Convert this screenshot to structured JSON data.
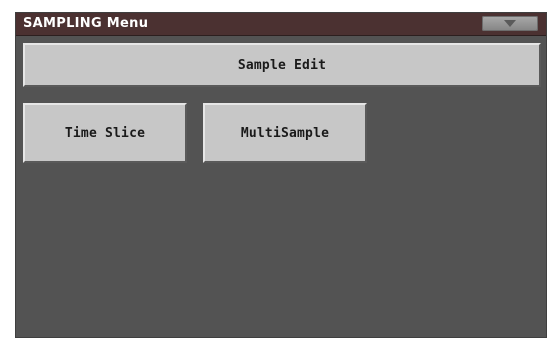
{
  "window": {
    "title": "SAMPLING Menu",
    "menu_icon": "triangle-down-icon"
  },
  "buttons": {
    "sample_edit": "Sample Edit",
    "time_slice": "Time Slice",
    "multisample": "MultiSample"
  },
  "colors": {
    "title_bar": "#4b3131",
    "panel_bg": "#535353",
    "button_face": "#c7c7c7"
  }
}
